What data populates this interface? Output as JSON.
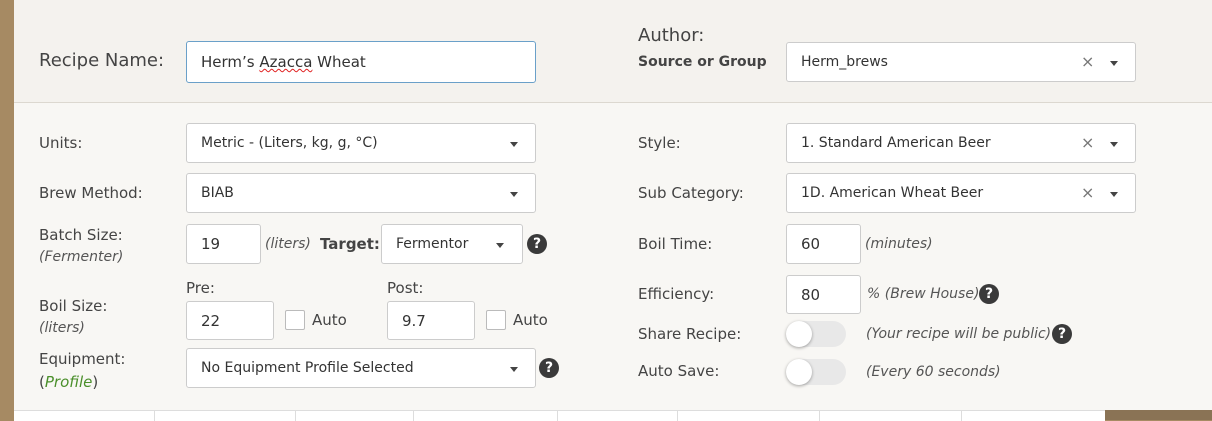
{
  "recipe_name": {
    "label": "Recipe Name:",
    "value_prefix": "Herm’s ",
    "value_misspelled": "Azacca",
    "value_suffix": " Wheat"
  },
  "author": {
    "label": "Author:",
    "sublabel": "Source or Group",
    "value": "Herm_brews"
  },
  "units": {
    "label": "Units:",
    "value": "Metric - (Liters, kg, g, °C)"
  },
  "brew_method": {
    "label": "Brew Method:",
    "value": "BIAB"
  },
  "batch_size": {
    "label": "Batch Size:",
    "sublabel": "(Fermenter)",
    "value": "19",
    "unit": "(liters)",
    "target_label": "Target:",
    "target_value": "Fermentor"
  },
  "boil_size": {
    "label": "Boil Size:",
    "sublabel": "(liters)",
    "pre_label": "Pre:",
    "pre_value": "22",
    "post_label": "Post:",
    "post_value": "9.7",
    "auto_label": "Auto"
  },
  "equipment": {
    "label": "Equipment:",
    "paren_open": "(",
    "link": "Profile",
    "paren_close": ")",
    "value": "No Equipment Profile Selected"
  },
  "style": {
    "label": "Style:",
    "value": "1. Standard American Beer"
  },
  "sub_category": {
    "label": "Sub Category:",
    "value": "1D. American Wheat Beer"
  },
  "boil_time": {
    "label": "Boil Time:",
    "value": "60",
    "unit": "(minutes)"
  },
  "efficiency": {
    "label": "Efficiency:",
    "value": "80",
    "unit": "% (Brew House)"
  },
  "share_recipe": {
    "label": "Share Recipe:",
    "note": "(Your recipe will be public)"
  },
  "auto_save": {
    "label": "Auto Save:",
    "note": "(Every 60 seconds)"
  },
  "icons": {
    "help": "?",
    "clear": "×"
  }
}
